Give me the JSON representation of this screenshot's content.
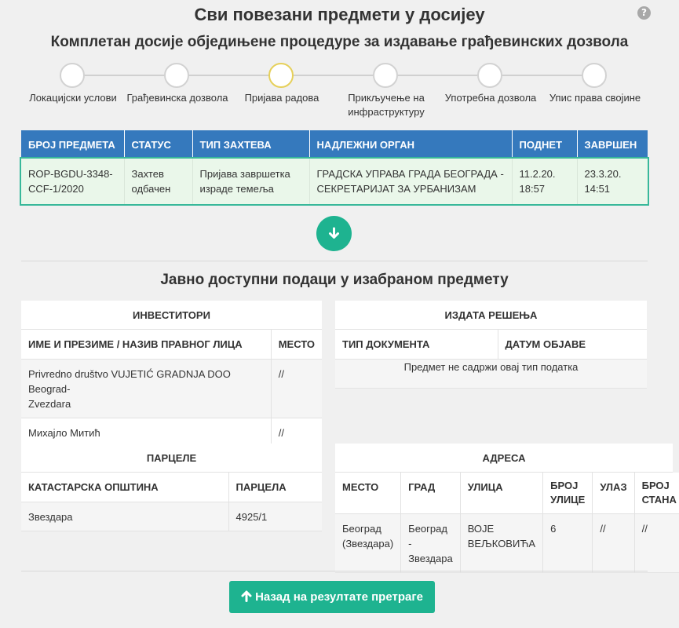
{
  "header": {
    "title": "Сви повезани предмети у досијеу",
    "subtitle": "Комплетан досије обједињене процедуре за издавање грађевинских дозвола",
    "help_icon": "?"
  },
  "steps": [
    {
      "label": "Локацијски услови"
    },
    {
      "label": "Грађевинска дозвола"
    },
    {
      "label": "Пријава радова"
    },
    {
      "label_line1": "Прикључење на",
      "label_line2": "инфраструктуру"
    },
    {
      "label": "Употребна дозвола"
    },
    {
      "label": "Упис права својине"
    }
  ],
  "active_step_color": "#e6d05a",
  "main_table": {
    "headers": [
      "БРОЈ ПРЕДМЕТА",
      "СТАТУС",
      "ТИП ЗАХТЕВА",
      "НАДЛЕЖНИ ОРГАН",
      "ПОДНЕТ",
      "ЗАВРШЕН"
    ],
    "row": {
      "case_number_line1": "ROP-BGDU-3348-",
      "case_number_line2": "CCF-1/2020",
      "status_line1": "Захтев",
      "status_line2": "одбачен",
      "type_line1": "Пријава завршетка",
      "type_line2": "израде темеља",
      "authority_line1": "ГРАДСКА УПРАВА ГРАДА БЕОГРАДА -",
      "authority_line2": "СЕКРЕТАРИЈАТ ЗА УРБАНИЗАМ",
      "submitted_line1": "11.2.20.",
      "submitted_line2": "18:57",
      "completed_line1": "23.3.20.",
      "completed_line2": "14:51"
    }
  },
  "section_title": "Јавно доступни подаци у изабраном предмету",
  "investors": {
    "title": "ИНВЕСТИТОРИ",
    "headers": [
      "ИМЕ И ПРЕЗИМЕ / НАЗИВ ПРАВНОГ ЛИЦА",
      "МЕСТО"
    ],
    "rows": [
      {
        "name_line1": "Privredno društvo VUJETIĆ GRADNJA DOO Beograd-",
        "name_line2": "Zvezdara",
        "place": "//"
      },
      {
        "name": "Михајло Митић",
        "place": "//"
      }
    ]
  },
  "decisions": {
    "title": "ИЗДАТА РЕШЕЊА",
    "headers": [
      "ТИП ДОКУМЕНТА",
      "ДАТУМ ОБЈАВЕ"
    ],
    "empty_message": "Предмет не садржи овај тип податка"
  },
  "parcels": {
    "title": "ПАРЦЕЛЕ",
    "headers": [
      "КАТАСТАРСКА ОПШТИНА",
      "ПАРЦЕЛА"
    ],
    "rows": [
      {
        "municipality": "Звездара",
        "parcel": "4925/1"
      }
    ]
  },
  "address": {
    "title": "АДРЕСА",
    "headers": {
      "place": "МЕСТО",
      "city": "ГРАД",
      "street": "УЛИЦА",
      "street_no_line1": "БРОЈ",
      "street_no_line2": "УЛИЦЕ",
      "entrance": "УЛАЗ",
      "apt_line1": "БРОЈ",
      "apt_line2": "СТАНА"
    },
    "row": {
      "place_line1": "Београд",
      "place_line2": "(Звездара)",
      "city_line1": "Београд -",
      "city_line2": "Звездара",
      "street_line1": "ВОЈЕ",
      "street_line2": "ВЕЉКОВИЋА",
      "street_no": "6",
      "entrance": "//",
      "apt": "//"
    }
  },
  "back_button": {
    "label": "Назад на резултате претраге"
  },
  "colors": {
    "header_blue": "#3579bd",
    "accent_green": "#1eb390",
    "row_highlight": "#eaf7ea"
  }
}
